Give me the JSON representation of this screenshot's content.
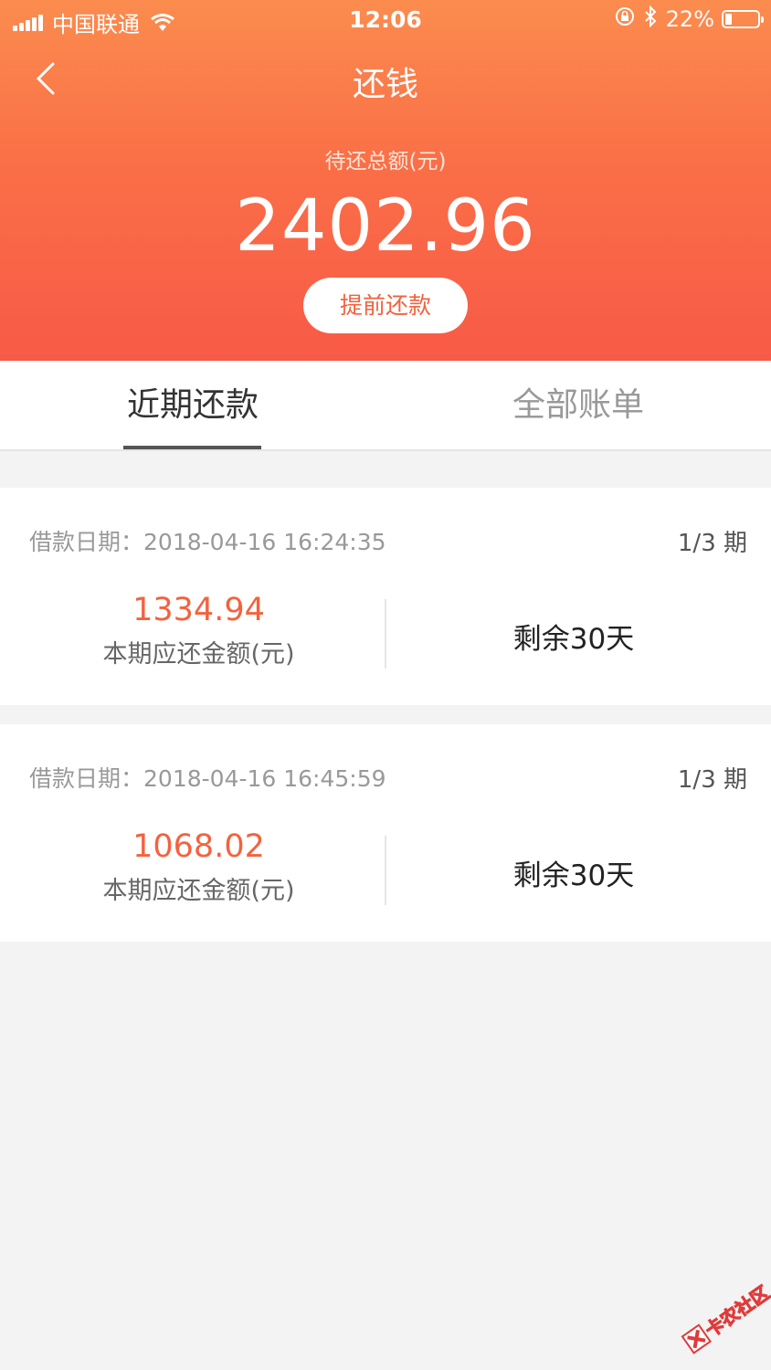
{
  "status_bar": {
    "carrier": "中国联通",
    "time": "12:06",
    "battery": "22%"
  },
  "header": {
    "title": "还钱",
    "total_label": "待还总额(元)",
    "total_amount": "2402.96",
    "prepay_label": "提前还款"
  },
  "tabs": [
    {
      "label": "近期还款",
      "active": true
    },
    {
      "label": "全部账单",
      "active": false
    }
  ],
  "bills": [
    {
      "date_label": "借款日期：",
      "date": "2018-04-16 16:24:35",
      "period": "1/3 期",
      "amount": "1334.94",
      "amount_label": "本期应还金额(元)",
      "remaining": "剩余30天"
    },
    {
      "date_label": "借款日期：",
      "date": "2018-04-16 16:45:59",
      "period": "1/3 期",
      "amount": "1068.02",
      "amount_label": "本期应还金额(元)",
      "remaining": "剩余30天"
    }
  ],
  "colors": {
    "header_top": "#fb8c4e",
    "header_bottom": "#f85a47",
    "accent": "#f4623e"
  },
  "watermark": "卡农社区"
}
